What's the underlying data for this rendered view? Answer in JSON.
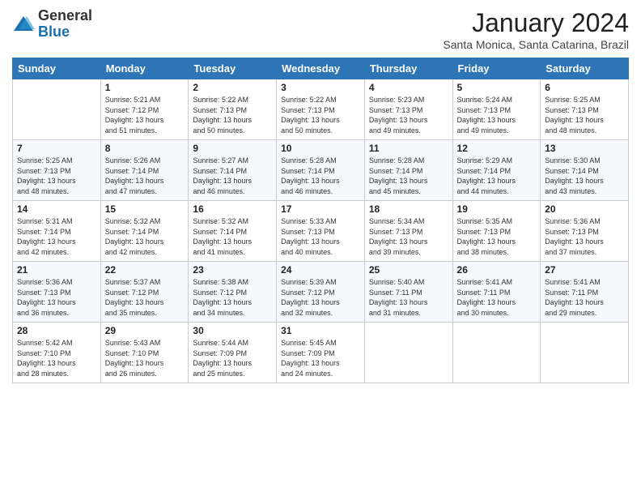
{
  "logo": {
    "general": "General",
    "blue": "Blue"
  },
  "header": {
    "month_title": "January 2024",
    "location": "Santa Monica, Santa Catarina, Brazil"
  },
  "days_of_week": [
    "Sunday",
    "Monday",
    "Tuesday",
    "Wednesday",
    "Thursday",
    "Friday",
    "Saturday"
  ],
  "weeks": [
    [
      {
        "day": "",
        "info": ""
      },
      {
        "day": "1",
        "info": "Sunrise: 5:21 AM\nSunset: 7:12 PM\nDaylight: 13 hours\nand 51 minutes."
      },
      {
        "day": "2",
        "info": "Sunrise: 5:22 AM\nSunset: 7:13 PM\nDaylight: 13 hours\nand 50 minutes."
      },
      {
        "day": "3",
        "info": "Sunrise: 5:22 AM\nSunset: 7:13 PM\nDaylight: 13 hours\nand 50 minutes."
      },
      {
        "day": "4",
        "info": "Sunrise: 5:23 AM\nSunset: 7:13 PM\nDaylight: 13 hours\nand 49 minutes."
      },
      {
        "day": "5",
        "info": "Sunrise: 5:24 AM\nSunset: 7:13 PM\nDaylight: 13 hours\nand 49 minutes."
      },
      {
        "day": "6",
        "info": "Sunrise: 5:25 AM\nSunset: 7:13 PM\nDaylight: 13 hours\nand 48 minutes."
      }
    ],
    [
      {
        "day": "7",
        "info": "Sunrise: 5:25 AM\nSunset: 7:13 PM\nDaylight: 13 hours\nand 48 minutes."
      },
      {
        "day": "8",
        "info": "Sunrise: 5:26 AM\nSunset: 7:14 PM\nDaylight: 13 hours\nand 47 minutes."
      },
      {
        "day": "9",
        "info": "Sunrise: 5:27 AM\nSunset: 7:14 PM\nDaylight: 13 hours\nand 46 minutes."
      },
      {
        "day": "10",
        "info": "Sunrise: 5:28 AM\nSunset: 7:14 PM\nDaylight: 13 hours\nand 46 minutes."
      },
      {
        "day": "11",
        "info": "Sunrise: 5:28 AM\nSunset: 7:14 PM\nDaylight: 13 hours\nand 45 minutes."
      },
      {
        "day": "12",
        "info": "Sunrise: 5:29 AM\nSunset: 7:14 PM\nDaylight: 13 hours\nand 44 minutes."
      },
      {
        "day": "13",
        "info": "Sunrise: 5:30 AM\nSunset: 7:14 PM\nDaylight: 13 hours\nand 43 minutes."
      }
    ],
    [
      {
        "day": "14",
        "info": "Sunrise: 5:31 AM\nSunset: 7:14 PM\nDaylight: 13 hours\nand 42 minutes."
      },
      {
        "day": "15",
        "info": "Sunrise: 5:32 AM\nSunset: 7:14 PM\nDaylight: 13 hours\nand 42 minutes."
      },
      {
        "day": "16",
        "info": "Sunrise: 5:32 AM\nSunset: 7:14 PM\nDaylight: 13 hours\nand 41 minutes."
      },
      {
        "day": "17",
        "info": "Sunrise: 5:33 AM\nSunset: 7:13 PM\nDaylight: 13 hours\nand 40 minutes."
      },
      {
        "day": "18",
        "info": "Sunrise: 5:34 AM\nSunset: 7:13 PM\nDaylight: 13 hours\nand 39 minutes."
      },
      {
        "day": "19",
        "info": "Sunrise: 5:35 AM\nSunset: 7:13 PM\nDaylight: 13 hours\nand 38 minutes."
      },
      {
        "day": "20",
        "info": "Sunrise: 5:36 AM\nSunset: 7:13 PM\nDaylight: 13 hours\nand 37 minutes."
      }
    ],
    [
      {
        "day": "21",
        "info": "Sunrise: 5:36 AM\nSunset: 7:13 PM\nDaylight: 13 hours\nand 36 minutes."
      },
      {
        "day": "22",
        "info": "Sunrise: 5:37 AM\nSunset: 7:12 PM\nDaylight: 13 hours\nand 35 minutes."
      },
      {
        "day": "23",
        "info": "Sunrise: 5:38 AM\nSunset: 7:12 PM\nDaylight: 13 hours\nand 34 minutes."
      },
      {
        "day": "24",
        "info": "Sunrise: 5:39 AM\nSunset: 7:12 PM\nDaylight: 13 hours\nand 32 minutes."
      },
      {
        "day": "25",
        "info": "Sunrise: 5:40 AM\nSunset: 7:11 PM\nDaylight: 13 hours\nand 31 minutes."
      },
      {
        "day": "26",
        "info": "Sunrise: 5:41 AM\nSunset: 7:11 PM\nDaylight: 13 hours\nand 30 minutes."
      },
      {
        "day": "27",
        "info": "Sunrise: 5:41 AM\nSunset: 7:11 PM\nDaylight: 13 hours\nand 29 minutes."
      }
    ],
    [
      {
        "day": "28",
        "info": "Sunrise: 5:42 AM\nSunset: 7:10 PM\nDaylight: 13 hours\nand 28 minutes."
      },
      {
        "day": "29",
        "info": "Sunrise: 5:43 AM\nSunset: 7:10 PM\nDaylight: 13 hours\nand 26 minutes."
      },
      {
        "day": "30",
        "info": "Sunrise: 5:44 AM\nSunset: 7:09 PM\nDaylight: 13 hours\nand 25 minutes."
      },
      {
        "day": "31",
        "info": "Sunrise: 5:45 AM\nSunset: 7:09 PM\nDaylight: 13 hours\nand 24 minutes."
      },
      {
        "day": "",
        "info": ""
      },
      {
        "day": "",
        "info": ""
      },
      {
        "day": "",
        "info": ""
      }
    ]
  ]
}
